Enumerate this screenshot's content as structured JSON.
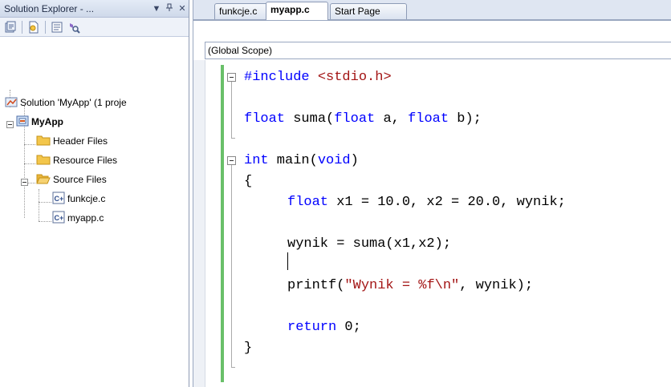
{
  "solution_explorer": {
    "title": "Solution Explorer - ...",
    "controls": {
      "dropdown": "▼",
      "pin": "⫫",
      "close": "✕"
    },
    "toolbar_icons": [
      "properties-icon",
      "show-all-files-icon",
      "view-code-icon",
      "class-view-icon"
    ],
    "tree": {
      "solution": "Solution 'MyApp' (1 proje",
      "project": "MyApp",
      "header_files": "Header Files",
      "resource_files": "Resource Files",
      "source_files": "Source Files",
      "file1": "funkcje.c",
      "file2": "myapp.c"
    }
  },
  "editor": {
    "tabs": [
      {
        "label": "funkcje.c",
        "active": false
      },
      {
        "label": "myapp.c",
        "active": true
      },
      {
        "label": "Start Page",
        "active": false
      }
    ],
    "scope": "(Global Scope)",
    "code": {
      "l1_kw": "#include",
      "l1_str": " <stdio.h>",
      "l2_kw1": "float",
      "l2_a": " suma(",
      "l2_kw2": "float",
      "l2_b": " a, ",
      "l2_kw3": "float",
      "l2_c": " b);",
      "l3_kw": "int",
      "l3_a": " main(",
      "l3_kw2": "void",
      "l3_b": ")",
      "l4": "{",
      "l5_kw": "float",
      "l5_a": " x1 = 10.0, x2 = 20.0, wynik;",
      "l6": "wynik = suma(x1,x2);",
      "l7_a": "printf(",
      "l7_str": "\"Wynik = %f\\n\"",
      "l7_b": ", wynik);",
      "l8_kw": "return",
      "l8_a": " 0;",
      "l9": "}"
    }
  },
  "colors": {
    "keyword": "#0000ff",
    "string": "#a31515",
    "change_bar": "#69c069"
  }
}
